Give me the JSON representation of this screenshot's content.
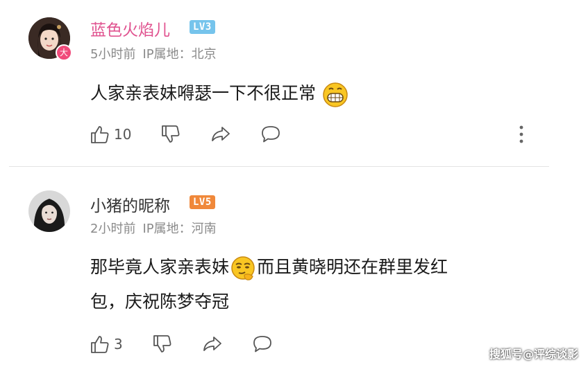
{
  "comments": [
    {
      "username": "蓝色火焰儿",
      "username_color": "#e0528f",
      "level": "LV3",
      "level_color": "#76c4ec",
      "avatar_badge": "大",
      "time": "5小时前",
      "ip_label": "IP属地：",
      "ip_location": "北京",
      "content_lines": [
        "人家亲表妹嘚瑟一下不很正常"
      ],
      "content_emoji": "grinning-face-icon",
      "likes": "10"
    },
    {
      "username": "小猪的昵称",
      "username_color": "#333333",
      "level": "LV5",
      "level_color": "#f0883a",
      "time": "2小时前",
      "ip_label": "IP属地：",
      "ip_location": "河南",
      "content_part1": "那毕竟人家亲表妹",
      "content_emoji": "smirking-thinking-face-icon",
      "content_part2": "而且黄晓明还在群里发红",
      "content_line2": "包，庆祝陈梦夺冠",
      "likes": "3"
    }
  ],
  "watermark": "搜狐号@评综谈影"
}
